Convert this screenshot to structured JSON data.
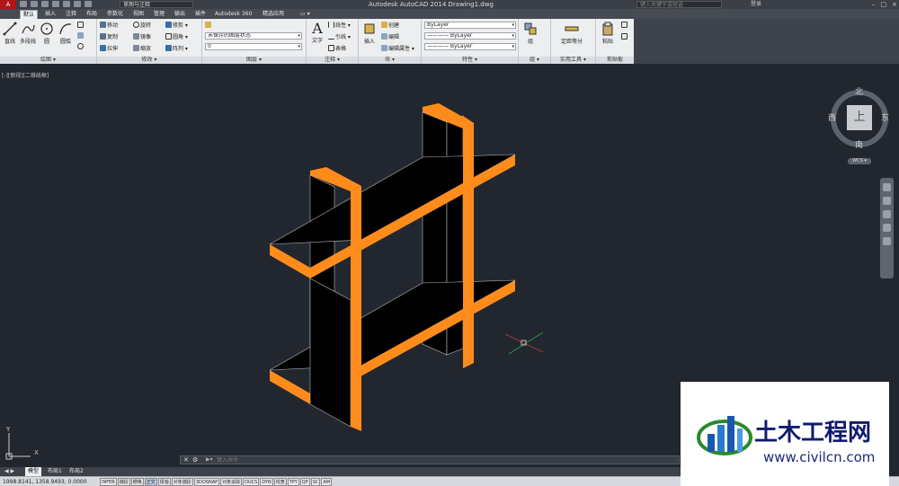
{
  "titlebar": {
    "app_button": "A",
    "workspace": "草图与注释",
    "title": "Autodesk AutoCAD 2014    Drawing1.dwg",
    "search_placeholder": "键入关键字或短语",
    "login": "登录",
    "window_controls": [
      "–",
      "□",
      "×"
    ]
  },
  "tabs": [
    {
      "label": "默认",
      "active": true
    },
    {
      "label": "插入"
    },
    {
      "label": "注释"
    },
    {
      "label": "布局"
    },
    {
      "label": "参数化"
    },
    {
      "label": "视图"
    },
    {
      "label": "管理"
    },
    {
      "label": "输出"
    },
    {
      "label": "插件"
    },
    {
      "label": "Autodesk 360"
    },
    {
      "label": "精选应用"
    },
    {
      "label": "▭ ▾"
    }
  ],
  "ribbon": {
    "draw": {
      "title": "绘图 ▾",
      "big": [
        "直线",
        "多段线",
        "圆",
        "圆弧"
      ]
    },
    "modify": {
      "title": "修改 ▾",
      "items": [
        "移动",
        "旋转",
        "修剪 ▾",
        "复制",
        "镜像",
        "圆角 ▾",
        "拉伸",
        "缩放",
        "阵列 ▾"
      ]
    },
    "layers": {
      "title": "图层 ▾",
      "state_combo": "未保存的图层状态",
      "layer_combo": "0"
    },
    "annotation": {
      "title": "注释 ▾",
      "big": "文字",
      "items": [
        "线性 ▾",
        "引线 ▾",
        "表格"
      ]
    },
    "block": {
      "title": "块 ▾",
      "big": "插入",
      "items": [
        "创建",
        "编辑",
        "编辑属性 ▾"
      ]
    },
    "properties": {
      "title": "特性 ▾",
      "combos": [
        "ByLayer",
        "———— ByLayer",
        "———— ByLayer"
      ]
    },
    "groups": {
      "title": "组 ▾",
      "big": "组"
    },
    "utilities": {
      "title": "实用工具 ▾",
      "big": "定距等分"
    },
    "clipboard": {
      "title": "剪贴板",
      "big": "粘贴"
    }
  },
  "viewport": {
    "label": "[-][俯视][二维线框]"
  },
  "viewcube": {
    "north": "北",
    "south": "南",
    "east": "东",
    "west": "西",
    "top": "上",
    "wcs": "WCS ▾"
  },
  "ucs": {
    "y": "Y",
    "x": "X"
  },
  "command": {
    "close": "✕",
    "wrench": "🔧",
    "prompt": "▶▾",
    "placeholder": "键入命令"
  },
  "layout_tabs": [
    {
      "label": "◀ ▶"
    },
    {
      "label": "模型",
      "active": true
    },
    {
      "label": "布局1"
    },
    {
      "label": "布局2"
    }
  ],
  "status": {
    "coords": "1998.8141, 1358.9493, 0.0000",
    "toggles": [
      {
        "label": "INFER"
      },
      {
        "label": "捕捉"
      },
      {
        "label": "栅格"
      },
      {
        "label": "正交",
        "on": true
      },
      {
        "label": "极轴"
      },
      {
        "label": "对象捕捉"
      },
      {
        "label": "3DOSNAP"
      },
      {
        "label": "对象追踪"
      },
      {
        "label": "DUCS"
      },
      {
        "label": "DYN"
      },
      {
        "label": "线宽"
      },
      {
        "label": "TPY"
      },
      {
        "label": "QP"
      },
      {
        "label": "SC"
      },
      {
        "label": "AM"
      }
    ]
  },
  "watermark": {
    "brand": "土木工程网",
    "url": "www.civilcn.com"
  },
  "colors": {
    "accent": "#ff8c1a",
    "canvas": "#22272f",
    "faces": "#000000"
  }
}
